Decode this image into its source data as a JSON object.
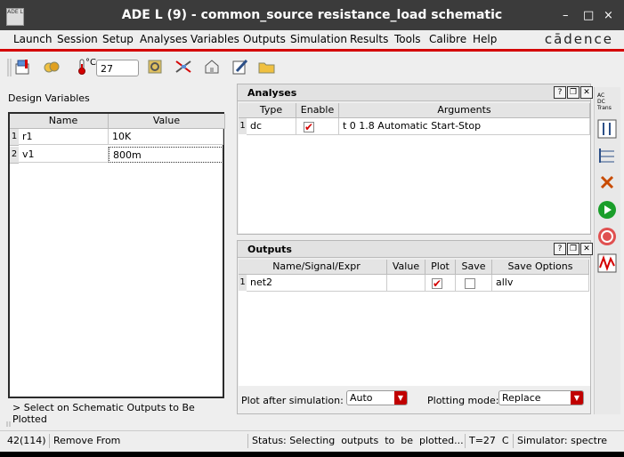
{
  "window": {
    "title": "ADE L (9) - common_source resistance_load schematic",
    "app_icon_text": "ADE L",
    "controls": {
      "minimize": "–",
      "maximize": "□",
      "close": "×"
    }
  },
  "menu": {
    "items": [
      "Launch",
      "Session",
      "Setup",
      "Analyses",
      "Variables",
      "Outputs",
      "Simulation",
      "Results",
      "Tools",
      "Calibre",
      "Help"
    ],
    "logo": "cādence"
  },
  "toolbar": {
    "temperature_label": "°C",
    "temperature_value": "27"
  },
  "design_variables": {
    "heading": "Design Variables",
    "columns": [
      "Name",
      "Value"
    ],
    "rows": [
      {
        "index": "1",
        "name": "r1",
        "value": "10K"
      },
      {
        "index": "2",
        "name": "v1",
        "value": "800m"
      }
    ],
    "hint": "> Select on Schematic Outputs to Be Plotted"
  },
  "analyses": {
    "title": "Analyses",
    "columns": [
      "Type",
      "Enable",
      "Arguments"
    ],
    "rows": [
      {
        "index": "1",
        "type": "dc",
        "enabled": true,
        "arguments": "t 0 1.8 Automatic Start-Stop"
      }
    ]
  },
  "outputs": {
    "title": "Outputs",
    "columns": [
      "Name/Signal/Expr",
      "Value",
      "Plot",
      "Save",
      "Save Options"
    ],
    "rows": [
      {
        "index": "1",
        "name": "net2",
        "value": "",
        "plot": true,
        "save": false,
        "save_options": "allv"
      }
    ],
    "plot_after_label": "Plot after simulation:",
    "plot_after_value": "Auto",
    "plotting_mode_label": "Plotting mode:",
    "plotting_mode_value": "Replace"
  },
  "sidebar": {
    "analysis_types": [
      "AC",
      "DC",
      "Trans"
    ]
  },
  "status": {
    "count": "42(114)",
    "mouse": "Remove From",
    "message": "Status: Selecting  outputs  to  be  plotted...",
    "temp": "T=27  C",
    "simulator": "Simulator: spectre"
  },
  "colors": {
    "accent_red": "#d40000",
    "titlebar": "#3b3b3b",
    "run_green": "#1a9e2a"
  }
}
